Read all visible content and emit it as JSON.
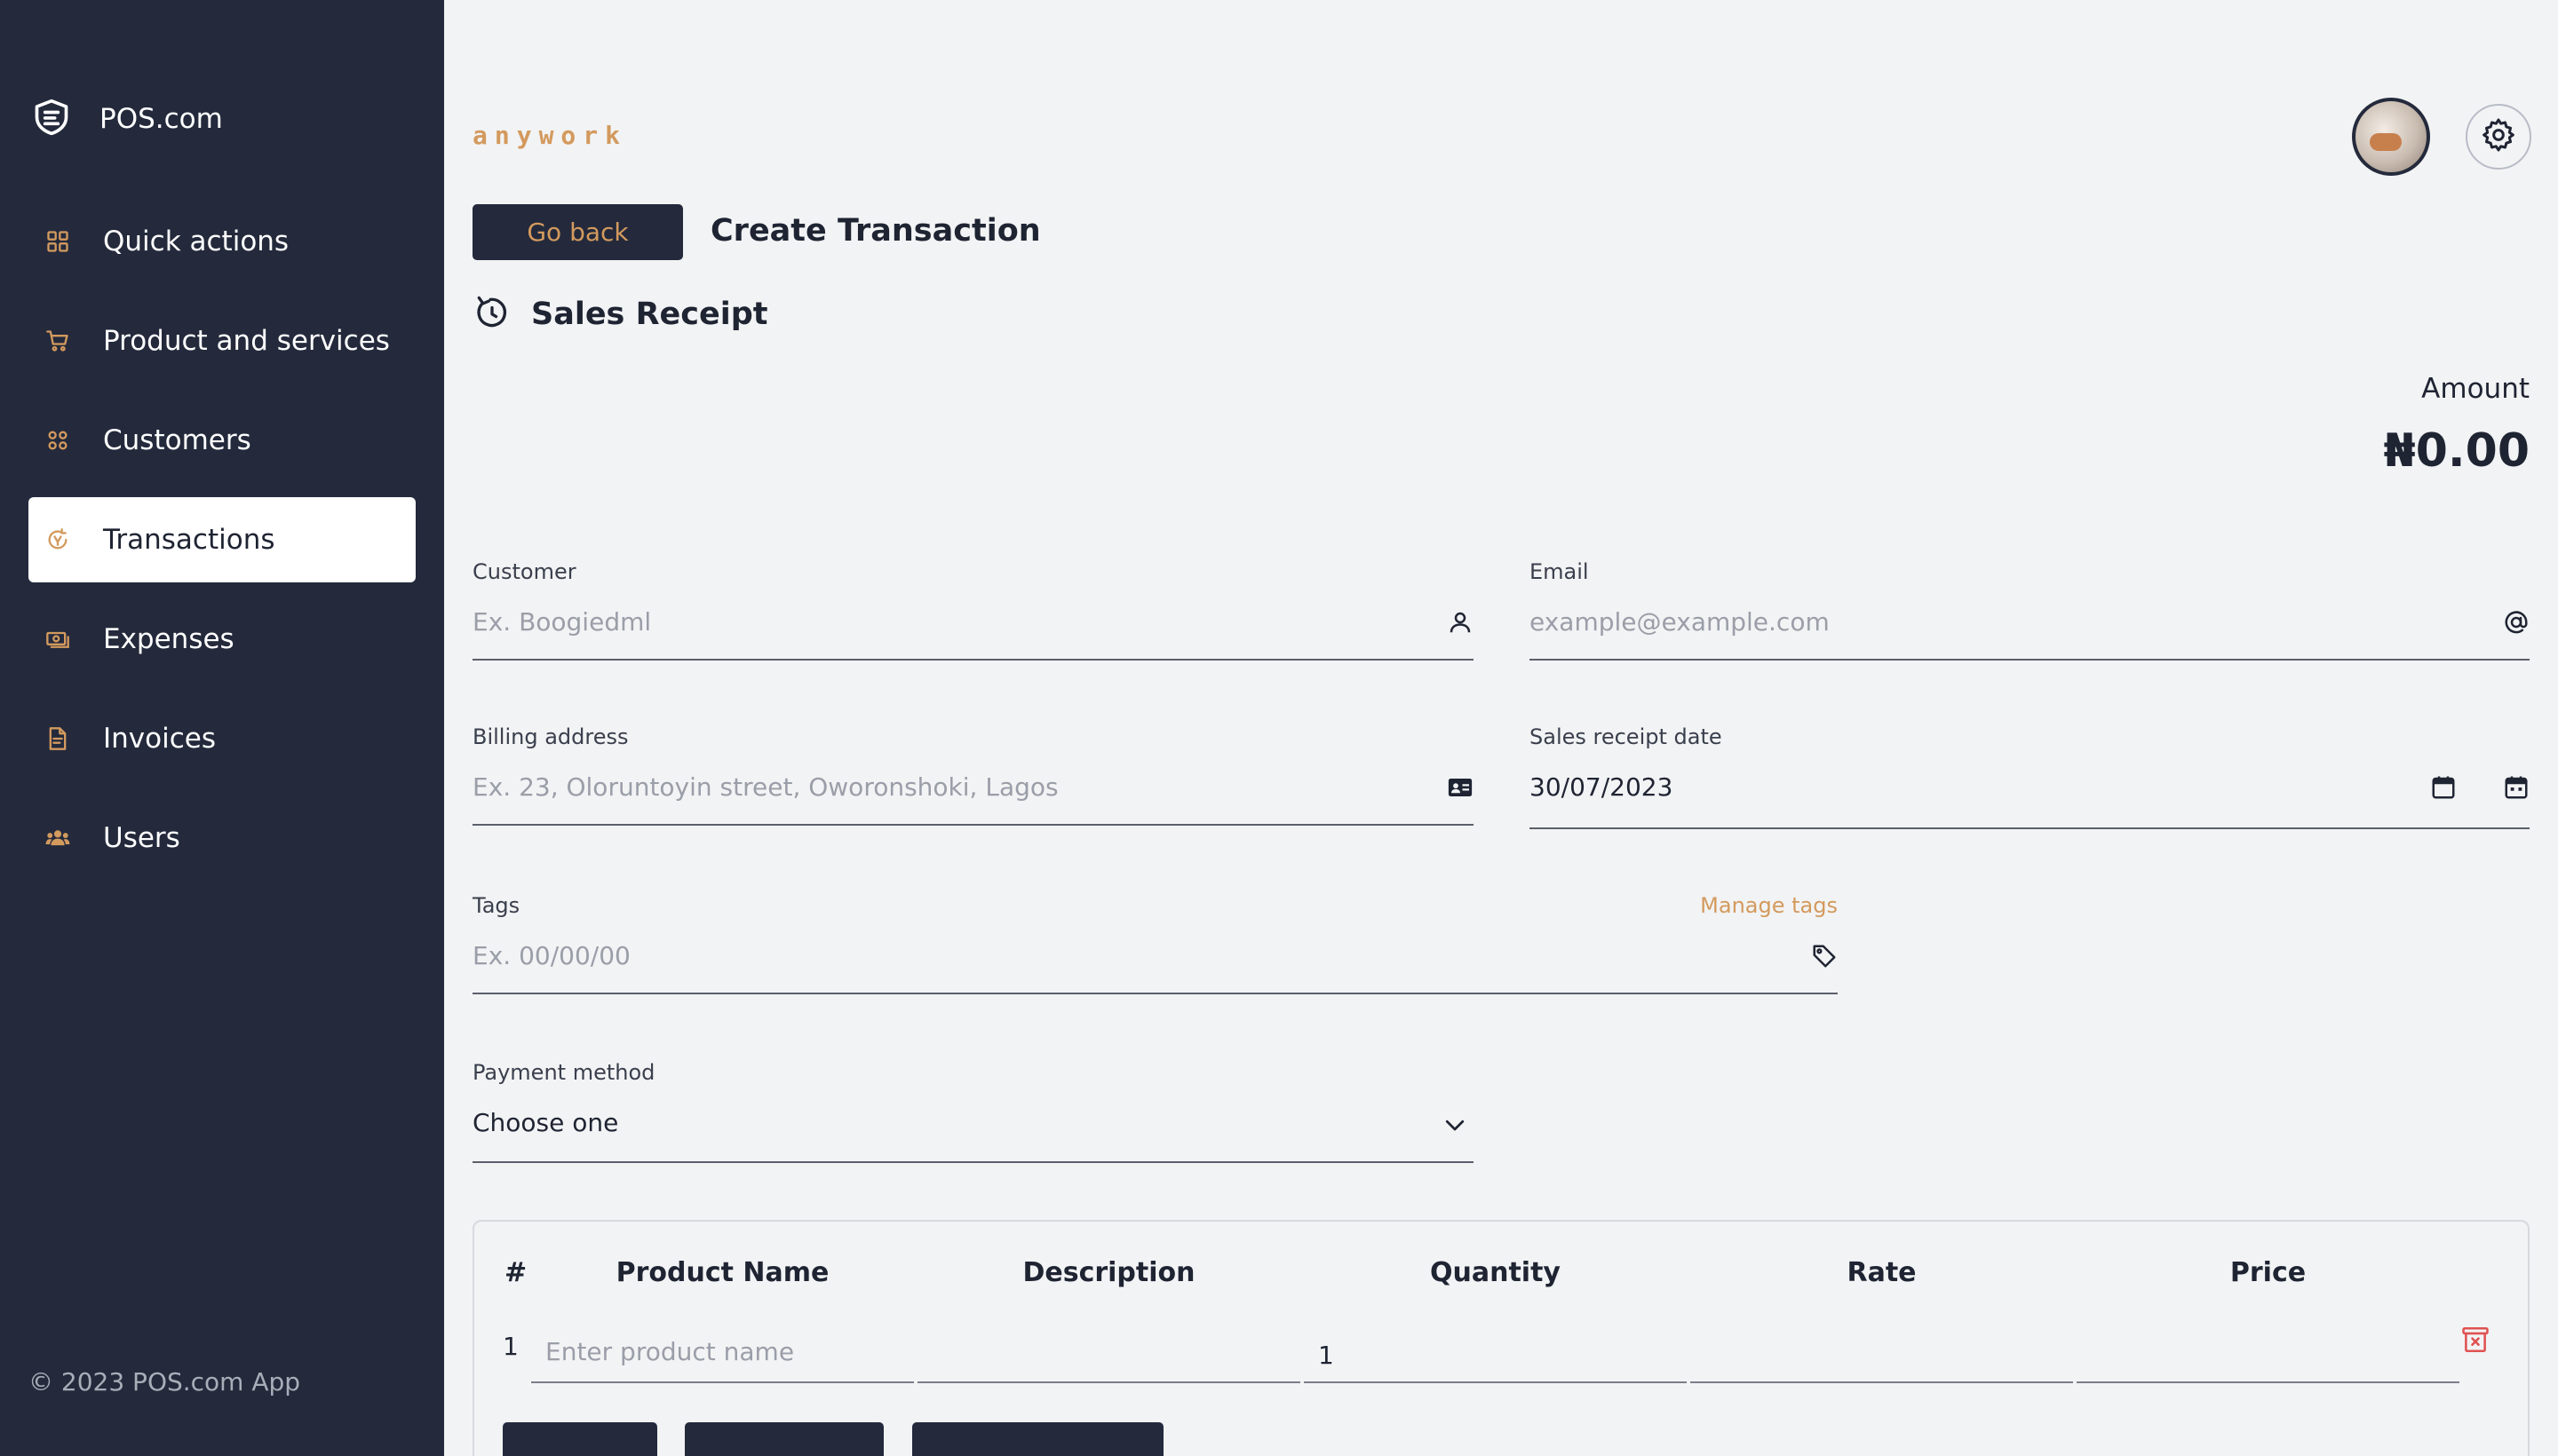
{
  "app": {
    "name": "POS.com",
    "footer": "© 2023 POS.com App"
  },
  "sidebar": {
    "items": [
      {
        "label": "Quick actions",
        "icon": "grid-icon"
      },
      {
        "label": "Product and services",
        "icon": "cart-icon"
      },
      {
        "label": "Customers",
        "icon": "customers-icon"
      },
      {
        "label": "Transactions",
        "icon": "transactions-icon",
        "active": true
      },
      {
        "label": "Expenses",
        "icon": "cash-icon"
      },
      {
        "label": "Invoices",
        "icon": "invoice-icon"
      },
      {
        "label": "Users",
        "icon": "users-icon"
      }
    ]
  },
  "header": {
    "company": "anywork"
  },
  "page": {
    "go_back": "Go back",
    "title": "Create Transaction",
    "section": "Sales Receipt"
  },
  "amount": {
    "label": "Amount",
    "value": "₦0.00"
  },
  "form": {
    "customer": {
      "label": "Customer",
      "placeholder": "Ex. Boogiedml"
    },
    "email": {
      "label": "Email",
      "placeholder": "example@example.com"
    },
    "billing": {
      "label": "Billing address",
      "placeholder": "Ex. 23, Oloruntoyin street, Oworonshoki, Lagos"
    },
    "date": {
      "label": "Sales receipt date",
      "value": "30/07/2023"
    },
    "tags": {
      "label": "Tags",
      "placeholder": "Ex. 00/00/00",
      "manage": "Manage tags"
    },
    "payment": {
      "label": "Payment method",
      "value": "Choose one"
    }
  },
  "table": {
    "headers": [
      "#",
      "Product Name",
      "Description",
      "Quantity",
      "Rate",
      "Price"
    ],
    "rows": [
      {
        "num": "1",
        "product_placeholder": "Enter product name",
        "description": "",
        "quantity": "1",
        "rate": "",
        "price": ""
      }
    ]
  },
  "colors": {
    "sidebar": "#242a3c",
    "accent": "#d39a5e",
    "background": "#f2f3f4",
    "danger": "#e05252"
  }
}
